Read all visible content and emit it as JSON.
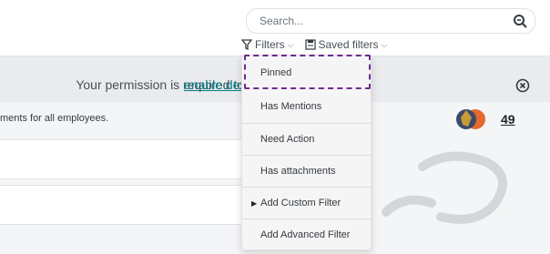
{
  "search": {
    "placeholder": "Search..."
  },
  "toolbar": {
    "filters_label": "Filters",
    "saved_filters_label": "Saved filters"
  },
  "notice": {
    "text": "Your permission is required to",
    "link": "enable desktop notifications"
  },
  "message": {
    "text_fragment": "ments for all employees.",
    "follower_count": "49"
  },
  "dropdown": {
    "items": [
      {
        "label": "Pinned"
      },
      {
        "label": "Has Mentions"
      },
      {
        "label": "Need Action"
      },
      {
        "label": "Has attachments"
      },
      {
        "label": "Add Custom Filter"
      },
      {
        "label": "Add Advanced Filter"
      }
    ]
  },
  "colors": {
    "accent": "#017e84",
    "highlight": "#6f2a8f"
  }
}
